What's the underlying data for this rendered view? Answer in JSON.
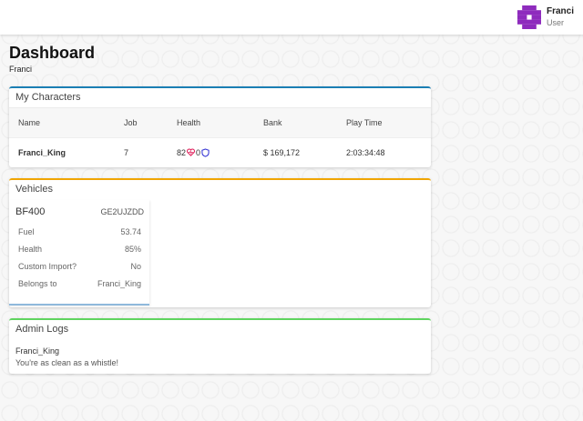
{
  "user": {
    "name": "Franci",
    "role": "User",
    "avatar_color": "#8e2bbd"
  },
  "page": {
    "title": "Dashboard",
    "subtitle": "Franci"
  },
  "characters": {
    "title": "My Characters",
    "accent": "#1b7fb4",
    "columns": [
      "Name",
      "Job",
      "Health",
      "Bank",
      "Play Time"
    ],
    "rows": [
      {
        "name": "Franci_King",
        "job": "7",
        "health": "82",
        "armor": "0",
        "bank": "$ 169,172",
        "play_time": "2:03:34:48"
      }
    ]
  },
  "vehicles": {
    "title": "Vehicles",
    "accent": "#f0a500",
    "items": [
      {
        "model": "BF400",
        "plate": "GE2UJZDD",
        "fields": [
          {
            "label": "Fuel",
            "value": "53.74"
          },
          {
            "label": "Health",
            "value": "85%"
          },
          {
            "label": "Custom Import?",
            "value": "No"
          },
          {
            "label": "Belongs to",
            "value": "Franci_King"
          }
        ]
      }
    ]
  },
  "logs": {
    "title": "Admin Logs",
    "accent": "#5fd45f",
    "user": "Franci_King",
    "message": "You're as clean as a whistle!"
  },
  "icons": {
    "avatar": "pixel-avatar-icon",
    "heart": "heart-icon",
    "shield": "shield-icon"
  }
}
